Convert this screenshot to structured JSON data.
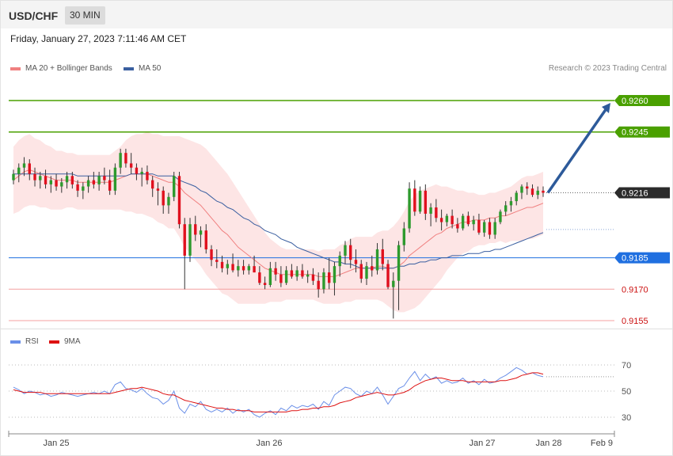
{
  "header": {
    "symbol": "USD/CHF",
    "timeframe": "30 MIN",
    "datetime": "Friday, January 27, 2023 7:11:46 AM CET"
  },
  "legend": {
    "ma20_label": "MA 20 + Bollinger Bands",
    "ma50_label": "MA 50",
    "credit": "Research © 2023 Trading Central"
  },
  "rsi_legend": {
    "rsi_label": "RSI",
    "ma9_label": "9MA"
  },
  "colors": {
    "up": "#2d9a2d",
    "down": "#e0101e",
    "ma20": "#f08080",
    "ma50": "#3a5fa0",
    "bollinger": "#fde0e0",
    "resistance": "#4aa000",
    "support_blue": "#1f6fe0",
    "support_red": "#cc1111",
    "current": "#333333",
    "arrow": "#2d5a9a",
    "rsi": "#6a8fe8",
    "rsi_ma": "#dd1111"
  },
  "chart_data": [
    {
      "type": "candlestick",
      "title": "USD/CHF",
      "ylim": [
        0.915,
        0.927
      ],
      "x_ticks": [
        "Jan 25",
        "Jan 26",
        "Jan 27",
        "Jan 28",
        "Feb 9"
      ],
      "levels": [
        {
          "value": 0.926,
          "label": "0.9260",
          "kind": "resistance"
        },
        {
          "value": 0.9245,
          "label": "0.9245",
          "kind": "resistance"
        },
        {
          "value": 0.9216,
          "label": "0.9216",
          "kind": "current"
        },
        {
          "value": 0.9185,
          "label": "0.9185",
          "kind": "support_blue"
        },
        {
          "value": 0.917,
          "label": "0.9170",
          "kind": "support_red"
        },
        {
          "value": 0.9155,
          "label": "0.9155",
          "kind": "support_red"
        }
      ],
      "projection": {
        "from": 0.9216,
        "to": 0.926
      },
      "candles": [
        [
          0.9222,
          0.9227,
          0.922,
          0.9225
        ],
        [
          0.9225,
          0.923,
          0.9221,
          0.9228
        ],
        [
          0.9228,
          0.9233,
          0.9224,
          0.923
        ],
        [
          0.923,
          0.9232,
          0.9222,
          0.9225
        ],
        [
          0.9225,
          0.9228,
          0.9219,
          0.9222
        ],
        [
          0.9222,
          0.9226,
          0.9218,
          0.9224
        ],
        [
          0.9224,
          0.9227,
          0.9218,
          0.922
        ],
        [
          0.922,
          0.9224,
          0.9216,
          0.9222
        ],
        [
          0.9222,
          0.9225,
          0.9217,
          0.9219
        ],
        [
          0.9219,
          0.9223,
          0.9216,
          0.9221
        ],
        [
          0.9221,
          0.9226,
          0.9218,
          0.9224
        ],
        [
          0.9224,
          0.9226,
          0.9218,
          0.922
        ],
        [
          0.922,
          0.9222,
          0.9214,
          0.9217
        ],
        [
          0.9217,
          0.9221,
          0.9213,
          0.9219
        ],
        [
          0.9219,
          0.9224,
          0.9216,
          0.9222
        ],
        [
          0.9222,
          0.9226,
          0.9218,
          0.922
        ],
        [
          0.922,
          0.9226,
          0.9217,
          0.9224
        ],
        [
          0.9224,
          0.9228,
          0.922,
          0.9222
        ],
        [
          0.9222,
          0.9227,
          0.9215,
          0.9217
        ],
        [
          0.9217,
          0.923,
          0.9215,
          0.9228
        ],
        [
          0.9228,
          0.9237,
          0.9225,
          0.9235
        ],
        [
          0.9235,
          0.9237,
          0.9228,
          0.923
        ],
        [
          0.923,
          0.9235,
          0.9225,
          0.9228
        ],
        [
          0.9228,
          0.923,
          0.9222,
          0.9225
        ],
        [
          0.9225,
          0.9228,
          0.9219,
          0.9226
        ],
        [
          0.9226,
          0.9229,
          0.922,
          0.9222
        ],
        [
          0.9222,
          0.9224,
          0.9214,
          0.9218
        ],
        [
          0.9218,
          0.9221,
          0.921,
          0.9217
        ],
        [
          0.9217,
          0.9219,
          0.9206,
          0.921
        ],
        [
          0.921,
          0.9216,
          0.9206,
          0.9214
        ],
        [
          0.9214,
          0.9226,
          0.9212,
          0.9224
        ],
        [
          0.9224,
          0.9226,
          0.9199,
          0.9201
        ],
        [
          0.9201,
          0.9204,
          0.917,
          0.9186
        ],
        [
          0.9186,
          0.9204,
          0.9183,
          0.9201
        ],
        [
          0.9201,
          0.9205,
          0.9193,
          0.9196
        ],
        [
          0.9196,
          0.92,
          0.919,
          0.9198
        ],
        [
          0.9198,
          0.9201,
          0.9187,
          0.9189
        ],
        [
          0.9189,
          0.9191,
          0.9181,
          0.9184
        ],
        [
          0.9184,
          0.9189,
          0.918,
          0.9183
        ],
        [
          0.9183,
          0.9186,
          0.9178,
          0.918
        ],
        [
          0.918,
          0.9184,
          0.9177,
          0.9182
        ],
        [
          0.9182,
          0.9187,
          0.9178,
          0.9179
        ],
        [
          0.9179,
          0.9184,
          0.9176,
          0.9181
        ],
        [
          0.9181,
          0.9184,
          0.9177,
          0.9179
        ],
        [
          0.9179,
          0.9182,
          0.9177,
          0.9181
        ],
        [
          0.9181,
          0.9186,
          0.9178,
          0.9178
        ],
        [
          0.9178,
          0.9181,
          0.9172,
          0.9173
        ],
        [
          0.9173,
          0.9176,
          0.917,
          0.9172
        ],
        [
          0.9172,
          0.9183,
          0.9171,
          0.918
        ],
        [
          0.918,
          0.9183,
          0.9174,
          0.9177
        ],
        [
          0.9177,
          0.9181,
          0.9171,
          0.9173
        ],
        [
          0.9173,
          0.9181,
          0.9172,
          0.9179
        ],
        [
          0.9179,
          0.9182,
          0.9175,
          0.9176
        ],
        [
          0.9176,
          0.9181,
          0.9174,
          0.9179
        ],
        [
          0.9179,
          0.9182,
          0.9175,
          0.9176
        ],
        [
          0.9176,
          0.9179,
          0.9173,
          0.9177
        ],
        [
          0.9177,
          0.918,
          0.9172,
          0.9174
        ],
        [
          0.9174,
          0.9178,
          0.9166,
          0.917
        ],
        [
          0.917,
          0.918,
          0.9168,
          0.9178
        ],
        [
          0.9178,
          0.9185,
          0.917,
          0.9173
        ],
        [
          0.9173,
          0.9183,
          0.9167,
          0.9181
        ],
        [
          0.9181,
          0.9188,
          0.9176,
          0.9186
        ],
        [
          0.9186,
          0.9193,
          0.9182,
          0.9191
        ],
        [
          0.9191,
          0.9194,
          0.918,
          0.9184
        ],
        [
          0.9184,
          0.9189,
          0.9178,
          0.9182
        ],
        [
          0.9182,
          0.9184,
          0.9173,
          0.9175
        ],
        [
          0.9175,
          0.9183,
          0.9172,
          0.9181
        ],
        [
          0.9181,
          0.9186,
          0.9176,
          0.9179
        ],
        [
          0.9179,
          0.9192,
          0.9177,
          0.9189
        ],
        [
          0.9189,
          0.9194,
          0.9179,
          0.9182
        ],
        [
          0.9182,
          0.9184,
          0.917,
          0.9171
        ],
        [
          0.9171,
          0.9178,
          0.9156,
          0.9174
        ],
        [
          0.9174,
          0.9193,
          0.916,
          0.9191
        ],
        [
          0.9191,
          0.9202,
          0.9188,
          0.9199
        ],
        [
          0.9199,
          0.9221,
          0.9197,
          0.9218
        ],
        [
          0.9218,
          0.9222,
          0.9205,
          0.9207
        ],
        [
          0.9207,
          0.9219,
          0.9206,
          0.9217
        ],
        [
          0.9217,
          0.922,
          0.9203,
          0.9206
        ],
        [
          0.9206,
          0.9211,
          0.92,
          0.9209
        ],
        [
          0.9209,
          0.9213,
          0.9202,
          0.9204
        ],
        [
          0.9204,
          0.9208,
          0.9198,
          0.9202
        ],
        [
          0.9202,
          0.9206,
          0.92,
          0.9205
        ],
        [
          0.9205,
          0.9208,
          0.9199,
          0.9201
        ],
        [
          0.9201,
          0.9204,
          0.9197,
          0.9199
        ],
        [
          0.9199,
          0.9206,
          0.9198,
          0.9205
        ],
        [
          0.9205,
          0.9207,
          0.92,
          0.9201
        ],
        [
          0.9201,
          0.9205,
          0.9198,
          0.9203
        ],
        [
          0.9203,
          0.9206,
          0.9196,
          0.9197
        ],
        [
          0.9197,
          0.9203,
          0.9195,
          0.9202
        ],
        [
          0.9202,
          0.9204,
          0.9194,
          0.9196
        ],
        [
          0.9196,
          0.9204,
          0.9194,
          0.9202
        ],
        [
          0.9202,
          0.9208,
          0.9201,
          0.9207
        ],
        [
          0.9207,
          0.9212,
          0.9205,
          0.921
        ],
        [
          0.921,
          0.9214,
          0.9207,
          0.9212
        ],
        [
          0.9212,
          0.9217,
          0.921,
          0.9216
        ],
        [
          0.9216,
          0.922,
          0.9213,
          0.9219
        ],
        [
          0.9219,
          0.9221,
          0.9215,
          0.9218
        ],
        [
          0.9218,
          0.922,
          0.9214,
          0.9215
        ],
        [
          0.9215,
          0.9219,
          0.9213,
          0.9217
        ],
        [
          0.9217,
          0.9219,
          0.9214,
          0.9216
        ]
      ],
      "ma20": [
        0.9222,
        0.9224,
        0.9226,
        0.9227,
        0.9226,
        0.9225,
        0.9224,
        0.9223,
        0.9222,
        0.9222,
        0.9222,
        0.9222,
        0.9221,
        0.9221,
        0.9221,
        0.9221,
        0.9221,
        0.9221,
        0.9221,
        0.9222,
        0.9223,
        0.9224,
        0.9225,
        0.9225,
        0.9225,
        0.9225,
        0.9224,
        0.9223,
        0.9222,
        0.9221,
        0.9221,
        0.9219,
        0.9216,
        0.9214,
        0.9212,
        0.921,
        0.9207,
        0.9204,
        0.9201,
        0.9198,
        0.9196,
        0.9193,
        0.919,
        0.9188,
        0.9186,
        0.9184,
        0.9182,
        0.918,
        0.9179,
        0.9178,
        0.9177,
        0.9177,
        0.9177,
        0.9177,
        0.9177,
        0.9177,
        0.9177,
        0.9176,
        0.9176,
        0.9176,
        0.9176,
        0.9177,
        0.9178,
        0.9179,
        0.918,
        0.918,
        0.918,
        0.918,
        0.9181,
        0.9181,
        0.918,
        0.918,
        0.9181,
        0.9183,
        0.9186,
        0.9188,
        0.919,
        0.9192,
        0.9194,
        0.9196,
        0.9197,
        0.9199,
        0.92,
        0.9201,
        0.9202,
        0.9202,
        0.9203,
        0.9203,
        0.9203,
        0.9204,
        0.9204,
        0.9205,
        0.9205,
        0.9206,
        0.9207,
        0.9208,
        0.9209,
        0.9209,
        0.921,
        0.9211
      ],
      "ma50": [
        0.9225,
        0.9225,
        0.9225,
        0.9225,
        0.9225,
        0.9225,
        0.9225,
        0.9225,
        0.9225,
        0.9225,
        0.9225,
        0.9225,
        0.9224,
        0.9224,
        0.9224,
        0.9224,
        0.9224,
        0.9224,
        0.9224,
        0.9224,
        0.9224,
        0.9224,
        0.9225,
        0.9225,
        0.9225,
        0.9225,
        0.9225,
        0.9224,
        0.9224,
        0.9224,
        0.9224,
        0.9222,
        0.9221,
        0.922,
        0.9219,
        0.9217,
        0.9216,
        0.9214,
        0.9212,
        0.9211,
        0.9209,
        0.9208,
        0.9206,
        0.9204,
        0.9203,
        0.9201,
        0.92,
        0.9198,
        0.9197,
        0.9196,
        0.9194,
        0.9193,
        0.9192,
        0.919,
        0.9189,
        0.9188,
        0.9187,
        0.9186,
        0.9185,
        0.9184,
        0.9183,
        0.9183,
        0.9182,
        0.9182,
        0.9181,
        0.918,
        0.918,
        0.918,
        0.918,
        0.918,
        0.918,
        0.918,
        0.9181,
        0.9181,
        0.9182,
        0.9182,
        0.9183,
        0.9183,
        0.9184,
        0.9184,
        0.9185,
        0.9185,
        0.9186,
        0.9186,
        0.9186,
        0.9187,
        0.9187,
        0.9187,
        0.9188,
        0.9188,
        0.9189,
        0.9189,
        0.919,
        0.9191,
        0.9192,
        0.9193,
        0.9194,
        0.9195,
        0.9196,
        0.9197
      ],
      "bb_width": [
        0.0016,
        0.0017,
        0.0017,
        0.0017,
        0.0016,
        0.0016,
        0.0015,
        0.0015,
        0.0014,
        0.0014,
        0.0013,
        0.0013,
        0.0013,
        0.0013,
        0.0013,
        0.0013,
        0.0013,
        0.0013,
        0.0013,
        0.0014,
        0.0015,
        0.0017,
        0.0018,
        0.0019,
        0.0019,
        0.002,
        0.002,
        0.0021,
        0.0021,
        0.0022,
        0.0022,
        0.0024,
        0.0026,
        0.0027,
        0.0028,
        0.0029,
        0.003,
        0.003,
        0.003,
        0.003,
        0.0029,
        0.0028,
        0.0027,
        0.0025,
        0.0023,
        0.0021,
        0.0019,
        0.0017,
        0.0015,
        0.0014,
        0.0013,
        0.0012,
        0.0012,
        0.0012,
        0.0012,
        0.0012,
        0.0012,
        0.0012,
        0.0013,
        0.0013,
        0.0013,
        0.0014,
        0.0014,
        0.0015,
        0.0015,
        0.0015,
        0.0015,
        0.0015,
        0.0016,
        0.0017,
        0.0018,
        0.002,
        0.0022,
        0.0024,
        0.0026,
        0.0027,
        0.0027,
        0.0026,
        0.0025,
        0.0024,
        0.0022,
        0.002,
        0.0018,
        0.0016,
        0.0015,
        0.0014,
        0.0013,
        0.0012,
        0.0012,
        0.0012,
        0.0012,
        0.0012,
        0.0013,
        0.0013,
        0.0014,
        0.0015,
        0.0015,
        0.0015,
        0.0015,
        0.0015
      ]
    },
    {
      "type": "line",
      "title": "RSI",
      "ylim": [
        20,
        80
      ],
      "y_ticks": [
        70,
        50,
        30
      ],
      "series": [
        {
          "name": "RSI",
          "values": [
            53,
            51,
            48,
            50,
            49,
            47,
            48,
            46,
            47,
            49,
            48,
            47,
            46,
            47,
            48,
            49,
            48,
            50,
            48,
            55,
            57,
            52,
            51,
            49,
            52,
            48,
            45,
            44,
            40,
            43,
            50,
            37,
            33,
            40,
            38,
            42,
            36,
            34,
            36,
            34,
            37,
            33,
            36,
            34,
            36,
            32,
            30,
            33,
            35,
            32,
            37,
            35,
            39,
            37,
            39,
            38,
            40,
            36,
            42,
            39,
            47,
            50,
            53,
            52,
            48,
            46,
            50,
            48,
            53,
            47,
            40,
            46,
            52,
            54,
            60,
            65,
            58,
            63,
            59,
            61,
            56,
            58,
            56,
            57,
            60,
            56,
            58,
            55,
            59,
            56,
            57,
            60,
            62,
            65,
            68,
            66,
            63,
            64,
            62,
            61
          ]
        },
        {
          "name": "9MA",
          "values": [
            51,
            50,
            49,
            49,
            49,
            49,
            48,
            48,
            48,
            48,
            48,
            48,
            48,
            48,
            48,
            48,
            48,
            48,
            48,
            49,
            50,
            51,
            52,
            52,
            53,
            52,
            51,
            50,
            48,
            47,
            47,
            45,
            43,
            42,
            41,
            40,
            39,
            38,
            37,
            37,
            36,
            36,
            35,
            35,
            35,
            34,
            34,
            34,
            34,
            34,
            34,
            34,
            35,
            35,
            36,
            36,
            37,
            37,
            38,
            38,
            39,
            41,
            42,
            43,
            45,
            46,
            47,
            48,
            49,
            48,
            47,
            47,
            48,
            49,
            51,
            54,
            56,
            58,
            59,
            60,
            60,
            59,
            58,
            58,
            58,
            57,
            57,
            57,
            57,
            57,
            57,
            58,
            58,
            59,
            60,
            62,
            63,
            64,
            64,
            63
          ]
        }
      ],
      "x_ticks": [
        "Jan 25",
        "Jan 26",
        "Jan 27",
        "Jan 28",
        "Feb 9"
      ]
    }
  ]
}
